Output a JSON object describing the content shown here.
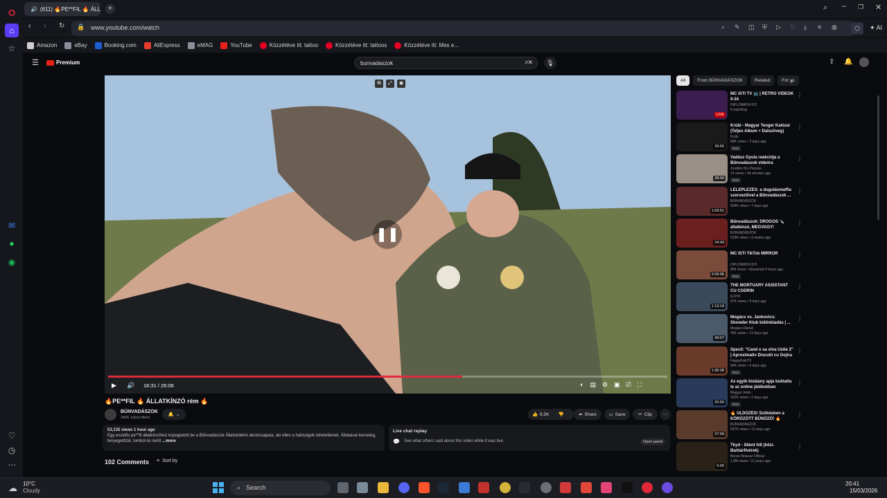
{
  "browser": {
    "tab_title": "(611) 🔥PE**FIL 🔥 ÁLL",
    "url": "www.youtube.com/watch",
    "ai_label": "AI"
  },
  "bookmarks": [
    {
      "label": "Amazon",
      "color": "#cfcfcf"
    },
    {
      "label": "eBay",
      "color": "#8a8f9a"
    },
    {
      "label": "Booking.com",
      "color": "#1c5fd1"
    },
    {
      "label": "AliExpress",
      "color": "#e53d2f"
    },
    {
      "label": "eMAG",
      "color": "#8a8f9a"
    },
    {
      "label": "YouTube",
      "color": "#e62117"
    },
    {
      "label": "Közzétéve itt: tattoo",
      "color": "#e60023"
    },
    {
      "label": "Közzétéve itt: tattoos",
      "color": "#e60023"
    },
    {
      "label": "Közzétéve itt: Mes e...",
      "color": "#e60023"
    }
  ],
  "youtube": {
    "logo": "Premium",
    "search_value": "bunvadaszok",
    "video": {
      "time": "16:31 / 26:06",
      "progress": 0.633,
      "title": "🔥PE**FIL 🔥 ÁLLATKÍNZÓ rém 🔥",
      "channel": "BÜNVADÁSZOK",
      "subscribers": "346K subscribers",
      "likes": "6,5K",
      "share": "Share",
      "save": "Save",
      "clip": "Clip",
      "views_line": "53,135 views  1 hour ago",
      "description": "Egy eszelős pe**fil állatkínzóhoz kopogtatott be a Bűnvadászok Állatvédelmi akciócsapata, aki ellen a hatóságok tehetetlenek. Állataival kerneteg, fenyegetőzik, tombol és üvölt",
      "more": "...more",
      "chat_title": "Live chat replay",
      "chat_text": "See what others said about this video while it was live.",
      "open_panel": "Open panel",
      "comments": "102 Comments",
      "sort_by": "Sort by"
    },
    "chips": [
      "All",
      "From BŰNVADÁSZOK",
      "Related",
      "For yo"
    ],
    "recommendations": [
      {
        "title": "MC ISTI TV 📺 | RETRO VIDEÓK 0-24",
        "channel": "DIPLOMATA ISTI",
        "meta": "8 watching",
        "duration": "LIVE",
        "badge": "",
        "color": "#3b1d4f"
      },
      {
        "title": "Krúbi - Magyar Tenger Kalózai (Teljes Album + Dalszöveg)",
        "channel": "Krúbi",
        "meta": "89K views • 3 days ago",
        "duration": "29:55",
        "badge": "New",
        "color": "#1a1a1a"
      },
      {
        "title": "Vadász Gyula reakciója a Bűnvadászok videóra",
        "channel": "Zsolikm DG Pányán",
        "meta": "14 views • 34 minutes ago",
        "duration": "28:00",
        "badge": "New",
        "color": "#9a8f86"
      },
      {
        "title": "LELEPLEZÉS: a dugulásmaffia szervezőivel a Bűnvadászok ...",
        "channel": "BŰNVADÁSZOK",
        "meta": "509K views • 7 days ago",
        "duration": "1:03:51",
        "badge": "",
        "color": "#5a2a2a"
      },
      {
        "title": "Bűnvadászok: DROGOS 🔪 állatkínzó, MEGVAGY!",
        "channel": "BŰNVADÁSZOK",
        "meta": "529K views • 3 weeks ago",
        "duration": "24:43",
        "badge": "",
        "color": "#6b1f1f"
      },
      {
        "title": "MC ISTI TikTok MIRROR",
        "channel": "DIPLOMATA ISTI",
        "meta": "859 views • Streamed 4 hours ago",
        "duration": "2:09:06",
        "badge": "New",
        "color": "#7a4a3a"
      },
      {
        "title": "THE MORTUARY ASSISTANT CU CODRIN",
        "channel": "ECHO",
        "meta": "97K views • 9 days ago",
        "duration": "1:13:14",
        "badge": "",
        "color": "#3a4a5a"
      },
      {
        "title": "Mogács vs. Jankovics: Showder Klub különkiadás | ...",
        "channel": "Mogács Dániel",
        "meta": "35K views • 13 days ago",
        "duration": "43:07",
        "badge": "",
        "color": "#4a5a6a"
      },
      {
        "title": "Specil: \"Cand o sa vina Ustie 2\" | Aproximativ Discutii cu Gojira |...",
        "channel": "HappyFishTV",
        "meta": "80K views • 6 days ago",
        "duration": "1:30:28",
        "badge": "New",
        "color": "#6a3a2a"
      },
      {
        "title": "Az egyik kisláány apja buktatta le az online játékokban gyereket...",
        "channel": "Magyar Jelen",
        "meta": "162K views • 2 days ago",
        "duration": "20:55",
        "badge": "New",
        "color": "#2a3a5a"
      },
      {
        "title": "🔥 ÜLDÖZÉS! Szökésben a KÖRÖZÖTT BŰNÖZŐ! 🔥",
        "channel": "BŰNVADÁSZOK",
        "meta": "547K views • 13 days ago",
        "duration": "27:09",
        "badge": "",
        "color": "#5a3a2a"
      },
      {
        "title": "Tkyd - Silent hill (közr. Barbárfivérek)",
        "channel": "Boose Brianaz Official",
        "meta": "1.8M views • 11 years ago",
        "duration": "5:00",
        "badge": "",
        "color": "#2a2218"
      }
    ]
  },
  "taskbar": {
    "weather_temp": "10°C",
    "weather_desc": "Cloudy",
    "search_label": "Search",
    "time": "20:41",
    "date": "15/03/2026"
  }
}
